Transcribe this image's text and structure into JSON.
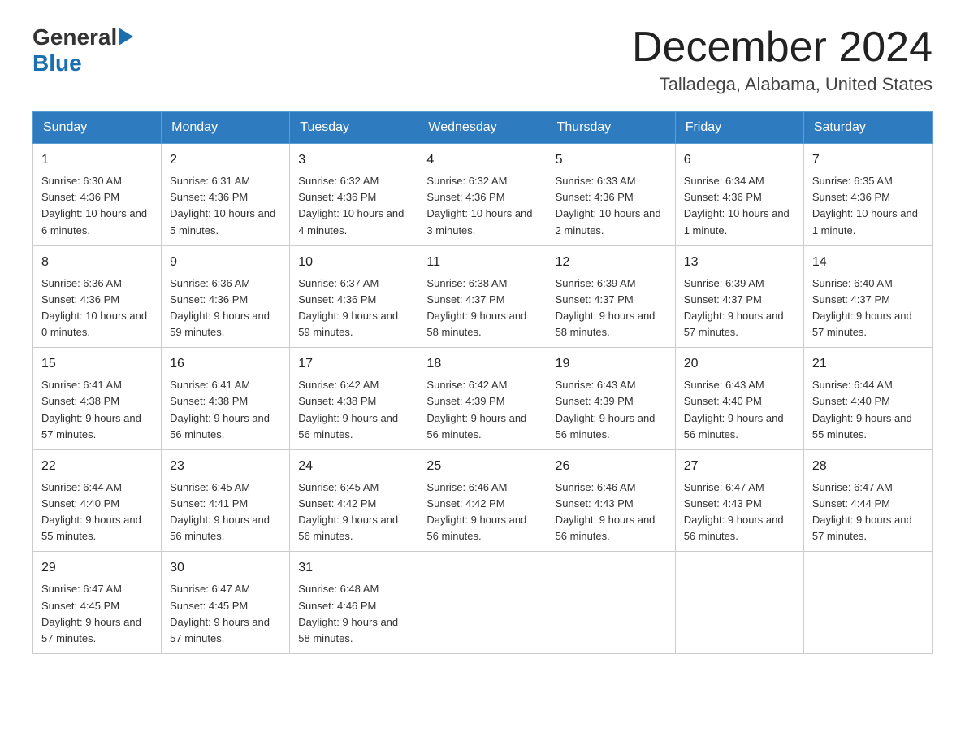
{
  "header": {
    "logo_general": "General",
    "logo_blue": "Blue",
    "month_title": "December 2024",
    "location": "Talladega, Alabama, United States"
  },
  "days_of_week": [
    "Sunday",
    "Monday",
    "Tuesday",
    "Wednesday",
    "Thursday",
    "Friday",
    "Saturday"
  ],
  "weeks": [
    [
      {
        "day": "1",
        "sunrise": "6:30 AM",
        "sunset": "4:36 PM",
        "daylight": "10 hours and 6 minutes."
      },
      {
        "day": "2",
        "sunrise": "6:31 AM",
        "sunset": "4:36 PM",
        "daylight": "10 hours and 5 minutes."
      },
      {
        "day": "3",
        "sunrise": "6:32 AM",
        "sunset": "4:36 PM",
        "daylight": "10 hours and 4 minutes."
      },
      {
        "day": "4",
        "sunrise": "6:32 AM",
        "sunset": "4:36 PM",
        "daylight": "10 hours and 3 minutes."
      },
      {
        "day": "5",
        "sunrise": "6:33 AM",
        "sunset": "4:36 PM",
        "daylight": "10 hours and 2 minutes."
      },
      {
        "day": "6",
        "sunrise": "6:34 AM",
        "sunset": "4:36 PM",
        "daylight": "10 hours and 1 minute."
      },
      {
        "day": "7",
        "sunrise": "6:35 AM",
        "sunset": "4:36 PM",
        "daylight": "10 hours and 1 minute."
      }
    ],
    [
      {
        "day": "8",
        "sunrise": "6:36 AM",
        "sunset": "4:36 PM",
        "daylight": "10 hours and 0 minutes."
      },
      {
        "day": "9",
        "sunrise": "6:36 AM",
        "sunset": "4:36 PM",
        "daylight": "9 hours and 59 minutes."
      },
      {
        "day": "10",
        "sunrise": "6:37 AM",
        "sunset": "4:36 PM",
        "daylight": "9 hours and 59 minutes."
      },
      {
        "day": "11",
        "sunrise": "6:38 AM",
        "sunset": "4:37 PM",
        "daylight": "9 hours and 58 minutes."
      },
      {
        "day": "12",
        "sunrise": "6:39 AM",
        "sunset": "4:37 PM",
        "daylight": "9 hours and 58 minutes."
      },
      {
        "day": "13",
        "sunrise": "6:39 AM",
        "sunset": "4:37 PM",
        "daylight": "9 hours and 57 minutes."
      },
      {
        "day": "14",
        "sunrise": "6:40 AM",
        "sunset": "4:37 PM",
        "daylight": "9 hours and 57 minutes."
      }
    ],
    [
      {
        "day": "15",
        "sunrise": "6:41 AM",
        "sunset": "4:38 PM",
        "daylight": "9 hours and 57 minutes."
      },
      {
        "day": "16",
        "sunrise": "6:41 AM",
        "sunset": "4:38 PM",
        "daylight": "9 hours and 56 minutes."
      },
      {
        "day": "17",
        "sunrise": "6:42 AM",
        "sunset": "4:38 PM",
        "daylight": "9 hours and 56 minutes."
      },
      {
        "day": "18",
        "sunrise": "6:42 AM",
        "sunset": "4:39 PM",
        "daylight": "9 hours and 56 minutes."
      },
      {
        "day": "19",
        "sunrise": "6:43 AM",
        "sunset": "4:39 PM",
        "daylight": "9 hours and 56 minutes."
      },
      {
        "day": "20",
        "sunrise": "6:43 AM",
        "sunset": "4:40 PM",
        "daylight": "9 hours and 56 minutes."
      },
      {
        "day": "21",
        "sunrise": "6:44 AM",
        "sunset": "4:40 PM",
        "daylight": "9 hours and 55 minutes."
      }
    ],
    [
      {
        "day": "22",
        "sunrise": "6:44 AM",
        "sunset": "4:40 PM",
        "daylight": "9 hours and 55 minutes."
      },
      {
        "day": "23",
        "sunrise": "6:45 AM",
        "sunset": "4:41 PM",
        "daylight": "9 hours and 56 minutes."
      },
      {
        "day": "24",
        "sunrise": "6:45 AM",
        "sunset": "4:42 PM",
        "daylight": "9 hours and 56 minutes."
      },
      {
        "day": "25",
        "sunrise": "6:46 AM",
        "sunset": "4:42 PM",
        "daylight": "9 hours and 56 minutes."
      },
      {
        "day": "26",
        "sunrise": "6:46 AM",
        "sunset": "4:43 PM",
        "daylight": "9 hours and 56 minutes."
      },
      {
        "day": "27",
        "sunrise": "6:47 AM",
        "sunset": "4:43 PM",
        "daylight": "9 hours and 56 minutes."
      },
      {
        "day": "28",
        "sunrise": "6:47 AM",
        "sunset": "4:44 PM",
        "daylight": "9 hours and 57 minutes."
      }
    ],
    [
      {
        "day": "29",
        "sunrise": "6:47 AM",
        "sunset": "4:45 PM",
        "daylight": "9 hours and 57 minutes."
      },
      {
        "day": "30",
        "sunrise": "6:47 AM",
        "sunset": "4:45 PM",
        "daylight": "9 hours and 57 minutes."
      },
      {
        "day": "31",
        "sunrise": "6:48 AM",
        "sunset": "4:46 PM",
        "daylight": "9 hours and 58 minutes."
      },
      null,
      null,
      null,
      null
    ]
  ],
  "labels": {
    "sunrise": "Sunrise: ",
    "sunset": "Sunset: ",
    "daylight": "Daylight: "
  }
}
